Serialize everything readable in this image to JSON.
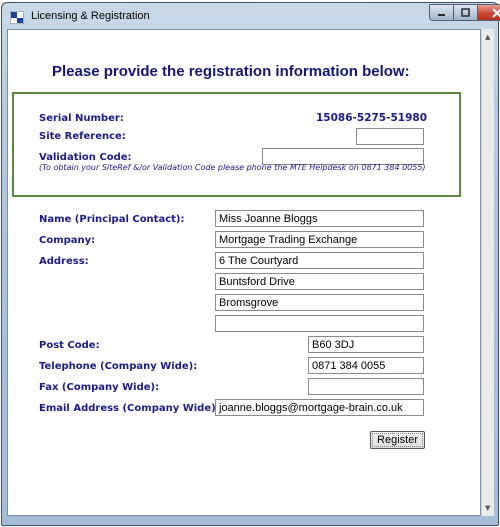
{
  "window": {
    "title": "Licensing & Registration"
  },
  "heading": "Please provide the registration information below:",
  "licence": {
    "serial_label": "Serial Number:",
    "serial_value": "15086-5275-51980",
    "site_ref_label": "Site Reference:",
    "site_ref_value": "",
    "validation_label": "Validation Code:",
    "validation_value": "",
    "note": "(To obtain your SiteRef &/or Validation Code please phone the MTE Helpdesk on 0871 384 0055)"
  },
  "form": {
    "name_label": "Name (Principal Contact):",
    "name_value": "Miss Joanne Bloggs",
    "company_label": "Company:",
    "company_value": "Mortgage Trading Exchange",
    "address_label": "Address:",
    "address_lines": [
      "6 The Courtyard",
      "Buntsford Drive",
      "Bromsgrove",
      ""
    ],
    "postcode_label": "Post Code:",
    "postcode_value": "B60 3DJ",
    "telephone_label": "Telephone (Company Wide):",
    "telephone_value": "0871 384 0055",
    "fax_label": "Fax (Company Wide):",
    "fax_value": "",
    "email_label": "Email Address (Company Wide):",
    "email_value": "joanne.bloggs@mortgage-brain.co.uk"
  },
  "buttons": {
    "register": "Register"
  },
  "colors": {
    "label": "#1a1a8c",
    "highlight_border": "#5b8a3c",
    "close_button": "#c94a36"
  },
  "icons": {
    "app": "window-app-icon",
    "minimize": "minimize-icon",
    "maximize": "maximize-icon",
    "close": "close-icon"
  }
}
